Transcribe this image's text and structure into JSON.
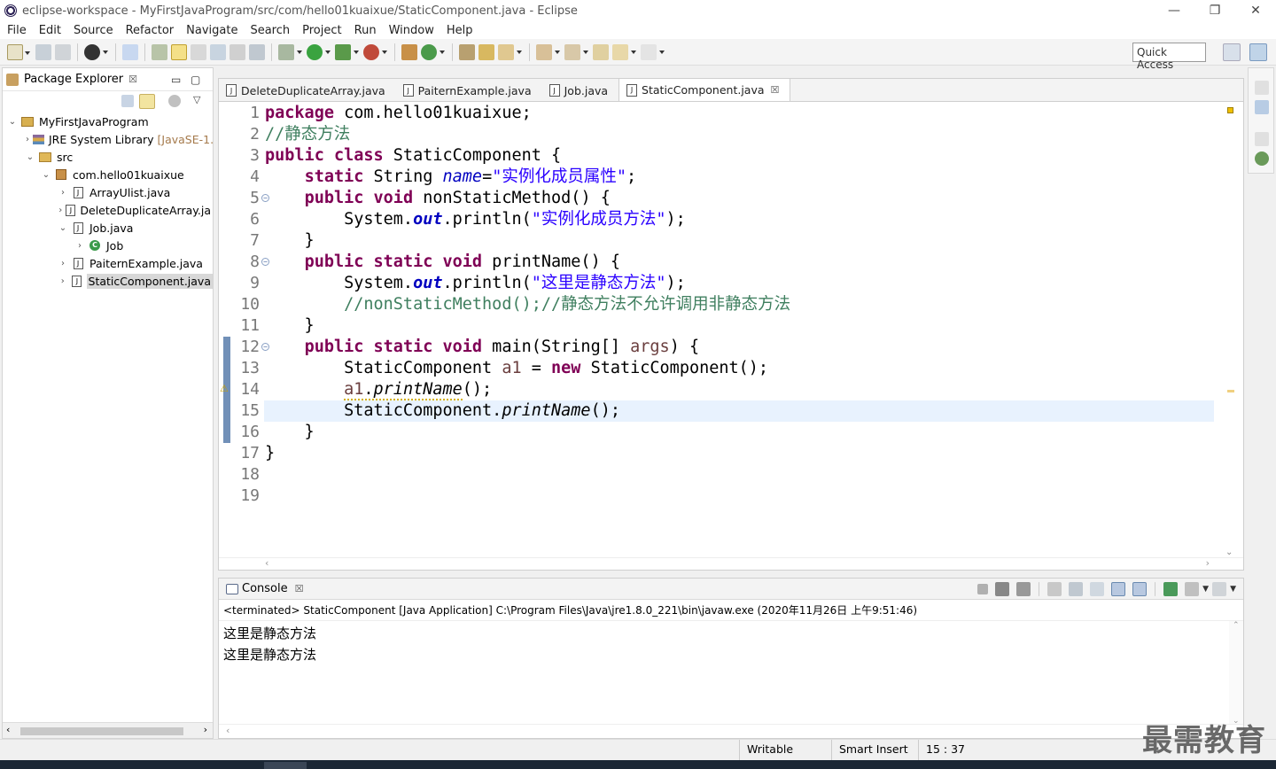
{
  "window": {
    "title": "eclipse-workspace - MyFirstJavaProgram/src/com/hello01kuaixue/StaticComponent.java - Eclipse",
    "minimize": "—",
    "restore": "❐",
    "close": "✕"
  },
  "menu": [
    "File",
    "Edit",
    "Source",
    "Refactor",
    "Navigate",
    "Search",
    "Project",
    "Run",
    "Window",
    "Help"
  ],
  "toolbar": {
    "quick_access": "Quick Access"
  },
  "package_explorer": {
    "title": "Package Explorer",
    "close": "☒",
    "tree": [
      {
        "label": "MyFirstJavaProgram",
        "arrow": "⌄",
        "icon": "project-icon"
      },
      {
        "label": "JRE System Library",
        "decoration": "[JavaSE-1.",
        "arrow": "›",
        "icon": "library-icon"
      },
      {
        "label": "src",
        "arrow": "⌄",
        "icon": "source-folder-icon"
      },
      {
        "label": "com.hello01kuaixue",
        "arrow": "⌄",
        "icon": "package-icon"
      },
      {
        "label": "ArrayUlist.java",
        "arrow": "›",
        "icon": "java-file-icon"
      },
      {
        "label": "DeleteDuplicateArray.ja",
        "arrow": "›",
        "icon": "java-file-icon"
      },
      {
        "label": "Job.java",
        "arrow": "⌄",
        "icon": "java-file-icon"
      },
      {
        "label": "Job",
        "arrow": "›",
        "icon": "class-icon"
      },
      {
        "label": "PaiternExample.java",
        "arrow": "›",
        "icon": "java-file-icon"
      },
      {
        "label": "StaticComponent.java",
        "arrow": "›",
        "icon": "java-file-icon",
        "selected": true
      }
    ]
  },
  "editor": {
    "tabs": [
      {
        "label": "DeleteDuplicateArray.java",
        "active": false
      },
      {
        "label": "PaiternExample.java",
        "active": false
      },
      {
        "label": "Job.java",
        "active": false
      },
      {
        "label": "StaticComponent.java",
        "active": true
      }
    ],
    "tab_close": "☒",
    "line_numbers": [
      "1",
      "2",
      "3",
      "4",
      "5",
      "6",
      "7",
      "8",
      "9",
      "10",
      "11",
      "12",
      "13",
      "14",
      "15",
      "16",
      "17",
      "18",
      "19"
    ],
    "lines": {
      "l1_kw": "package",
      "l1_rest": " com.hello01kuaixue;",
      "l2_comment": "//静态方法",
      "l3_kw": "public class",
      "l3_rest": " StaticComponent {",
      "l4_indent": "    ",
      "l4_kw": "static",
      "l4_type": " String ",
      "l4_field": "name",
      "l4_eq": "=",
      "l4_str": "\"实例化成员属性\"",
      "l4_end": ";",
      "l5_indent": "    ",
      "l5_kw": "public void",
      "l5_rest": " nonStaticMethod() {",
      "l6_pre": "        System.",
      "l6_out": "out",
      "l6_mid": ".println(",
      "l6_str": "\"实例化成员方法\"",
      "l6_end": ");",
      "l7": "    }",
      "l8_indent": "    ",
      "l8_kw": "public static void",
      "l8_rest": " printName() {",
      "l9_pre": "        System.",
      "l9_out": "out",
      "l9_mid": ".println(",
      "l9_str": "\"这里是静态方法\"",
      "l9_end": ");",
      "l10_indent": "        ",
      "l10_comment": "//nonStaticMethod();//静态方法不允许调用非静态方法",
      "l11": "    }",
      "l12_indent": "    ",
      "l12_kw": "public static void",
      "l12_mid": " main(String[] ",
      "l12_args": "args",
      "l12_end": ") {",
      "l13_pre": "        StaticComponent ",
      "l13_var": "a1",
      "l13_mid": " = ",
      "l13_kw": "new",
      "l13_end": " StaticComponent();",
      "l14_indent": "        ",
      "l14_var": "a1",
      "l14_dot": ".",
      "l14_method": "printName",
      "l14_end": "();",
      "l15_pre": "        StaticComponent.",
      "l15_method": "printName",
      "l15_end": "();",
      "l16": "    }",
      "l17": "}",
      "l18": "",
      "l19": ""
    }
  },
  "console": {
    "title": "Console",
    "close": "☒",
    "terminated": "<terminated> StaticComponent [Java Application] C:\\Program Files\\Java\\jre1.8.0_221\\bin\\javaw.exe (2020年11月26日 上午9:51:46)",
    "output": [
      "这里是静态方法",
      "这里是静态方法"
    ]
  },
  "status": {
    "writable": "Writable",
    "insert_mode": "Smart Insert",
    "position": "15 : 37"
  },
  "watermark": "最需教育",
  "colors": {
    "keyword": "#7f0055",
    "string": "#2a00ff",
    "comment": "#3f7f5f",
    "field": "#0000c0",
    "current_line": "#e8f2fe"
  }
}
